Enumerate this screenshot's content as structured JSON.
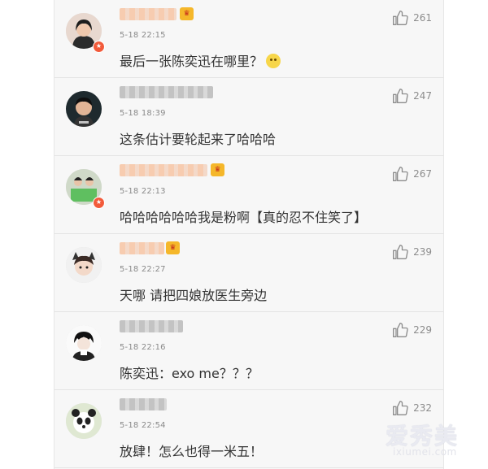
{
  "comments": [
    {
      "time": "5-18 22:15",
      "text": "最后一张陈奕迅在哪里？",
      "likes": "261",
      "has_emoji": true
    },
    {
      "time": "5-18 18:39",
      "text": "这条估计要轮起来了哈哈哈",
      "likes": "247"
    },
    {
      "time": "5-18 22:13",
      "text": "哈哈哈哈哈哈我是粉啊【真的忍不住笑了】",
      "likes": "267"
    },
    {
      "time": "5-18 22:27",
      "text": "天哪 请把四娘放医生旁边",
      "likes": "239"
    },
    {
      "time": "5-18 22:16",
      "text": "陈奕迅：exo me？？？",
      "likes": "229"
    },
    {
      "time": "5-18 22:54",
      "text": "放肆！怎么也得一米五！",
      "likes": "232"
    }
  ],
  "watermark": {
    "text": "爱秀美",
    "url": "ixiumei.com"
  },
  "colors": {
    "background": "#f7f7f7",
    "divider": "#e4e4e4",
    "timestamp": "#8a8a8a",
    "text": "#333333",
    "badge": "#f25a3a",
    "crown": "#f5b72a"
  },
  "icons": {
    "like": "thumbs-up-icon",
    "vip": "crown-icon",
    "verified": "verified-badge-icon"
  }
}
